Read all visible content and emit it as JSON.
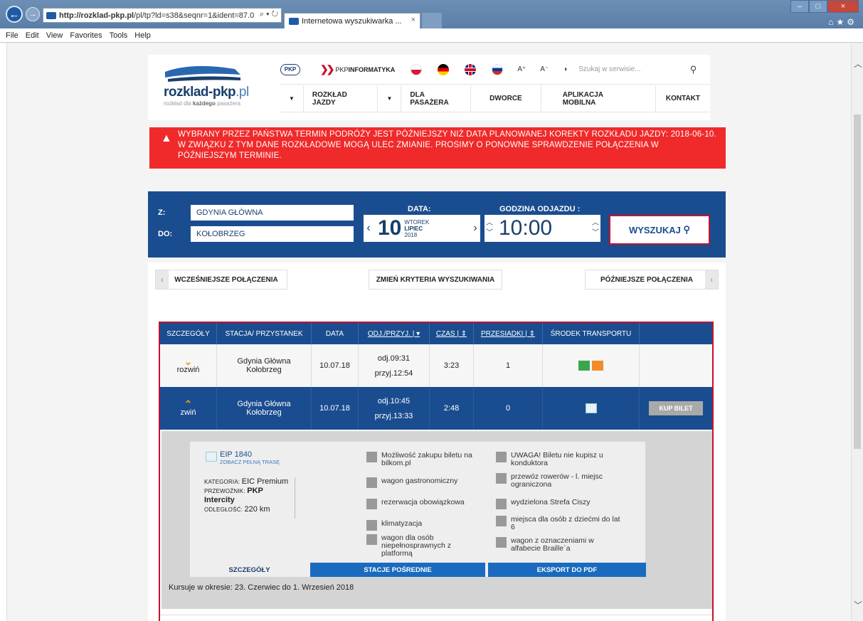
{
  "browser": {
    "url_domain": "http://rozklad-pkp.pl",
    "url_rest": "/pl/tp?ld=s38&seqnr=1&ident=87.0",
    "tab_title": "Internetowa wyszukiwarka ...",
    "menu": [
      "File",
      "Edit",
      "View",
      "Favorites",
      "Tools",
      "Help"
    ]
  },
  "header": {
    "logo_main": "rozklad-pkp",
    "logo_tld": ".pl",
    "logo_sub_a": "rozkład dla ",
    "logo_sub_b": "każdego",
    "logo_sub_c": " pasażera",
    "pkp_badge": "PKP",
    "pkp_inf_light": "PKP",
    "pkp_inf_bold": "INFORMATYKA",
    "font_plus": "A⁺",
    "font_minus": "A⁻",
    "search_placeholder": "Szukaj w serwisie...",
    "nav": [
      "ROZKŁAD JAZDY",
      "DLA PASAŻERA",
      "DWORCE",
      "APLIKACJA MOBILNA",
      "KONTAKT"
    ]
  },
  "alert": {
    "text": "WYBRANY PRZEZ PAŃSTWA TERMIN PODRÓŻY JEST PÓŹNIEJSZY NIŻ DATA PLANOWANEJ KOREKTY ROZKŁADU JAZDY: 2018-06-10. W ZWIĄZKU Z TYM DANE ROZKŁADOWE MOGĄ ULEC ZMIANIE. PROSIMY O PONOWNE SPRAWDZENIE POŁĄCZENIA W PÓŹNIEJSZYM TERMINIE."
  },
  "search": {
    "from_label": "Z:",
    "to_label": "DO:",
    "from_value": "GDYNIA GŁÓWNA",
    "to_value": "KOŁOBRZEG",
    "date_label": "DATA:",
    "date_day": "10",
    "date_weekday": "WTOREK",
    "date_month": "LIPIEC",
    "date_year": "2018",
    "hour_label": "GODZINA ODJAZDU :",
    "hour_value": "10:00",
    "find_button": "WYSZUKAJ"
  },
  "controls": {
    "earlier": "WCZEŚNIEJSZE POŁĄCZENIA",
    "change": "ZMIEŃ KRYTERIA WYSZUKIWANIA",
    "later": "PÓŹNIEJSZE POŁĄCZENIA"
  },
  "table": {
    "headers": [
      "SZCZEGÓŁY",
      "STACJA/ PRZYSTANEK",
      "DATA",
      "ODJ./PRZYJ.",
      "CZAS",
      "PRZESIADKI",
      "ŚRODEK TRANSPORTU"
    ],
    "rows": [
      {
        "toggle": "rozwiń",
        "from": "Gdynia Główna",
        "to": "Kołobrzeg",
        "date": "10.07.18",
        "dep": "odj.09:31",
        "arr": "przyj.12:54",
        "time": "3:23",
        "changes": "1"
      },
      {
        "toggle": "zwiń",
        "from": "Gdynia Główna",
        "to": "Kołobrzeg",
        "date": "10.07.18",
        "dep": "odj.10:45",
        "arr": "przyj.13:33",
        "time": "2:48",
        "changes": "0",
        "buy": "KUP BILET"
      }
    ]
  },
  "details": {
    "train": "EIP 1840",
    "route_link": "ZOBACZ PEŁNĄ TRASĘ",
    "category_k": "KATEGORIA: ",
    "category_v": "EIC Premium",
    "carrier_k": "PRZEWOŹNIK: ",
    "carrier_v": "PKP Intercity",
    "distance_k": "ODLEGŁOŚĆ: ",
    "distance_v": "220 km",
    "features_left": [
      "Możliwość zakupu biletu na bilkom.pl",
      "wagon gastronomiczny",
      "rezerwacja obowiązkowa",
      "klimatyzacja",
      "wagon dla osób niepełnosprawnych z platformą"
    ],
    "features_right": [
      "UWAGA! Biletu nie kupisz u konduktora",
      "przewóz rowerów - l. miejsc ograniczona",
      "wydzielona Strefa Ciszy",
      "miejsca dla osób z dziećmi do lat 6",
      "wagon z oznaczeniami w alfabecie Braille`a"
    ],
    "tabs": [
      "SZCZEGÓŁY",
      "STACJE POŚREDNIE",
      "EKSPORT DO PDF"
    ],
    "period": "Kursuje w okresie: 23. Czerwiec do 1. Wrzesień 2018"
  },
  "colors": {
    "primary": "#1a4d8f",
    "alert": "#f02a2a",
    "accent": "#c8102e"
  }
}
